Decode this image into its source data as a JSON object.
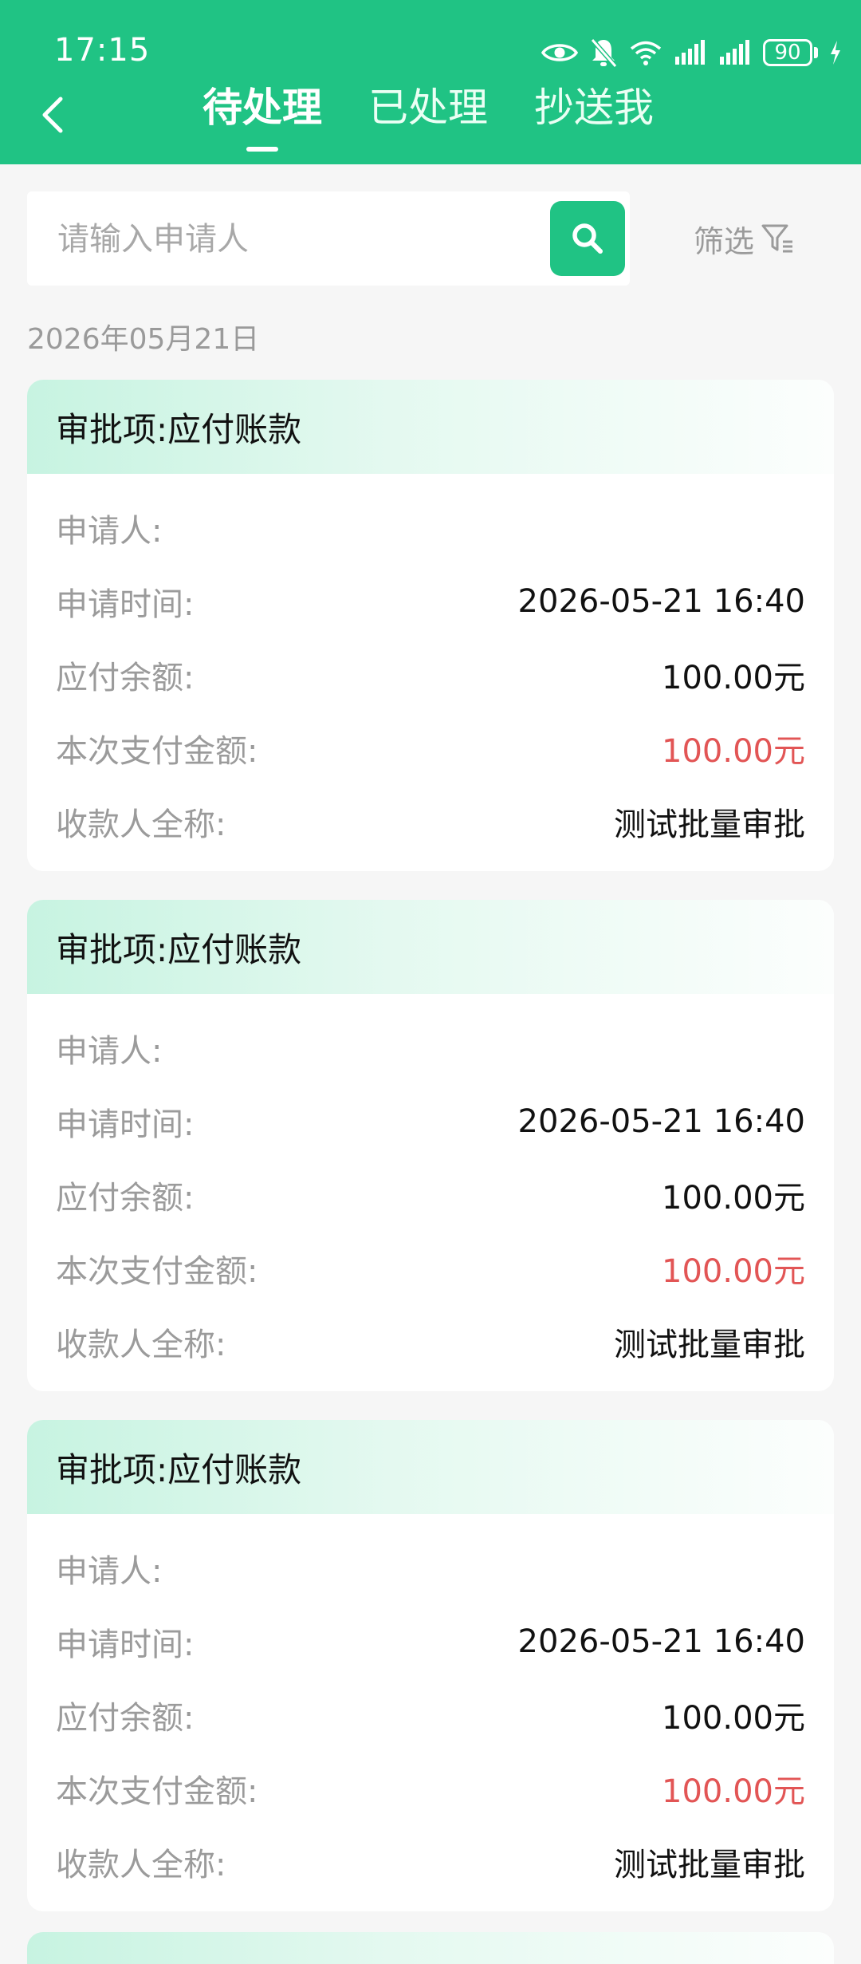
{
  "status_bar": {
    "time": "17:15",
    "battery": "90"
  },
  "tabs": [
    {
      "label": "待处理",
      "active": true
    },
    {
      "label": "已处理",
      "active": false
    },
    {
      "label": "抄送我",
      "active": false
    }
  ],
  "search": {
    "placeholder": "请输入申请人",
    "value": ""
  },
  "filter": {
    "label": "筛选"
  },
  "date_group": "2026年05月21日",
  "labels": {
    "title_prefix": "审批项:",
    "applicant": "申请人:",
    "apply_time": "申请时间:",
    "payable_balance": "应付余额:",
    "pay_amount": "本次支付金额:",
    "payee": "收款人全称:"
  },
  "cards": [
    {
      "title": "应付账款",
      "applicant": "",
      "apply_time": "2026-05-21 16:40",
      "payable_balance": "100.00元",
      "pay_amount": "100.00元",
      "payee": "测试批量审批"
    },
    {
      "title": "应付账款",
      "applicant": "",
      "apply_time": "2026-05-21 16:40",
      "payable_balance": "100.00元",
      "pay_amount": "100.00元",
      "payee": "测试批量审批"
    },
    {
      "title": "应付账款",
      "applicant": "",
      "apply_time": "2026-05-21 16:40",
      "payable_balance": "100.00元",
      "pay_amount": "100.00元",
      "payee": "测试批量审批"
    }
  ],
  "colors": {
    "brand": "#20c384",
    "amount_red": "#e25555"
  },
  "icons": [
    "eye-icon",
    "bell-off-icon",
    "wifi-icon",
    "signal-icon",
    "battery-icon",
    "charging-icon",
    "back-arrow-icon",
    "search-icon",
    "filter-icon"
  ]
}
